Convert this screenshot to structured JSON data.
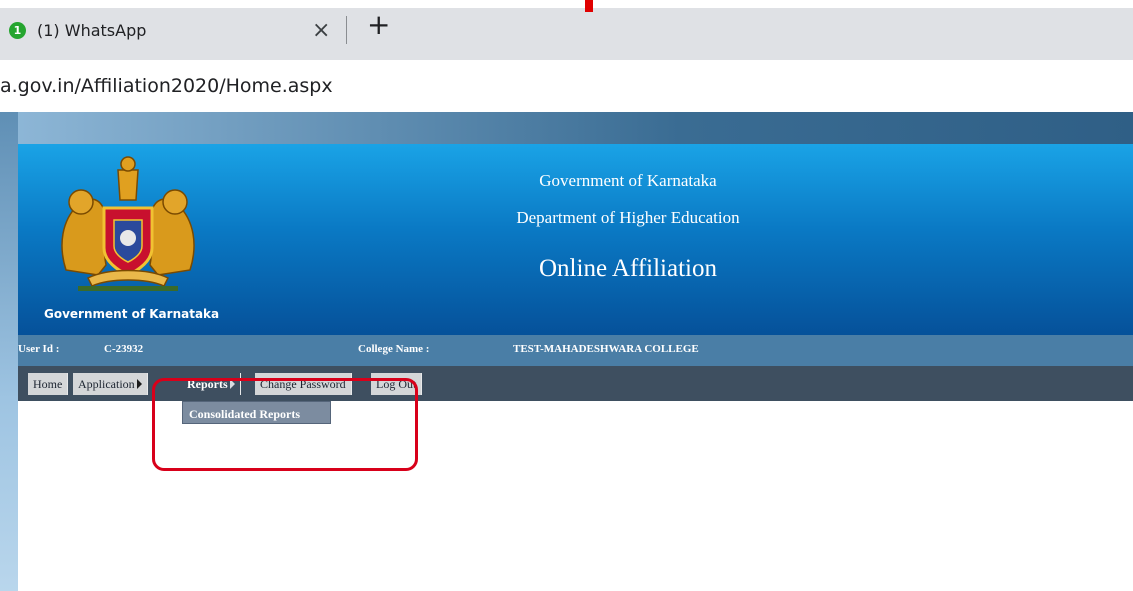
{
  "browser": {
    "tab_badge": "1",
    "tab_title": "(1) WhatsApp",
    "tab_close": "×",
    "new_tab": "+",
    "url": "a.gov.in/Affiliation2020/Home.aspx"
  },
  "banner": {
    "logo_caption": "Government of Karnataka",
    "line1": "Government of Karnataka",
    "line2": "Department of Higher Education",
    "line3": "Online Affiliation"
  },
  "userbar": {
    "user_id_label": "User Id :",
    "user_id_value": "C-23932",
    "college_label": "College Name :",
    "college_value": "TEST-MAHADESHWARA COLLEGE"
  },
  "menu": {
    "items": [
      {
        "label": "Home"
      },
      {
        "label": "Application"
      },
      {
        "label": "Reports"
      },
      {
        "label": "Change Password"
      },
      {
        "label": "Log Out"
      }
    ],
    "submenu": {
      "label": "Consolidated Reports"
    }
  },
  "colors": {
    "banner_top": "#1aa3e6",
    "banner_bottom": "#05519a",
    "userbar": "#4a7ea6",
    "menubar": "#3e4f60",
    "highlight": "#d8001a"
  }
}
